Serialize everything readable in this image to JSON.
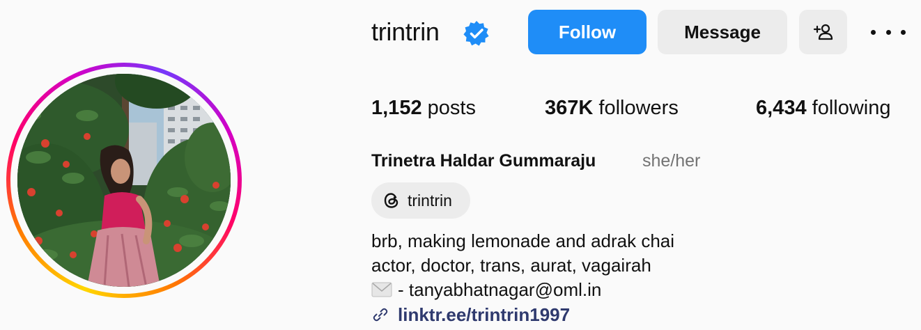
{
  "profile": {
    "username": "trintrin",
    "full_name": "Trinetra Haldar Gummaraju",
    "pronouns": "she/her",
    "verified": true
  },
  "actions": {
    "follow_label": "Follow",
    "message_label": "Message"
  },
  "stats": {
    "posts_count": "1,152",
    "posts_label": "posts",
    "followers_count": "367K",
    "followers_label": "followers",
    "following_count": "6,434",
    "following_label": "following"
  },
  "threads": {
    "handle": "trintrin",
    "icon": "threads-icon"
  },
  "bio": {
    "line1": "brb, making lemonade and adrak chai",
    "line2": "actor, doctor, trans, aurat, vagairah",
    "line3": "- tanyabhatnagar@oml.in",
    "link": "linktr.ee/trintrin1997"
  },
  "colors": {
    "follow_button": "#1f8df7",
    "secondary_button": "#ececec",
    "verified_badge": "#1f8df7",
    "link_text": "#2f3a6e",
    "muted_text": "#737373"
  }
}
